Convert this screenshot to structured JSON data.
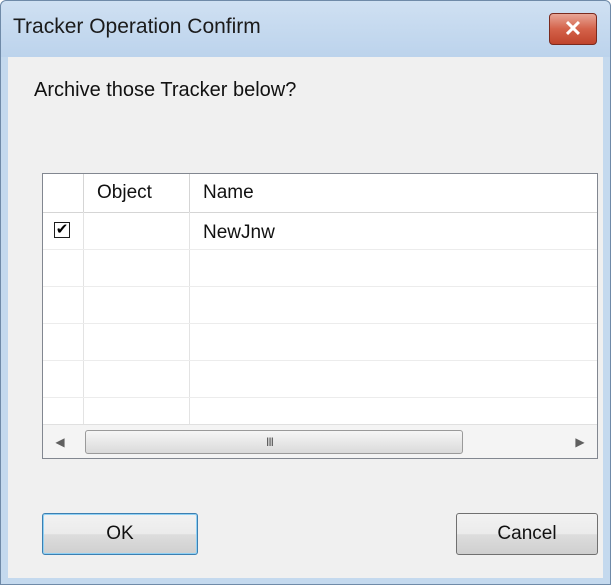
{
  "window": {
    "title": "Tracker Operation Confirm",
    "close_glyph": "✕",
    "close_icon": "close-icon"
  },
  "prompt": "Archive those Tracker below?",
  "grid": {
    "columns": [
      "",
      "Object",
      "Name"
    ],
    "rows": [
      {
        "checked": true,
        "check_glyph": "✔",
        "object": "",
        "name": "NewJnw"
      }
    ]
  },
  "scrollbar": {
    "left_arrow": "◀",
    "right_arrow": "▶",
    "grip": "III",
    "left_icon": "scroll-left-arrow-icon",
    "right_icon": "scroll-right-arrow-icon"
  },
  "buttons": {
    "ok": "OK",
    "cancel": "Cancel"
  },
  "colors": {
    "title_bar": "#c4d9ee",
    "close_button": "#c8503a",
    "default_button_border": "#3c7fb1",
    "dialog_body": "#f0f0f0"
  }
}
